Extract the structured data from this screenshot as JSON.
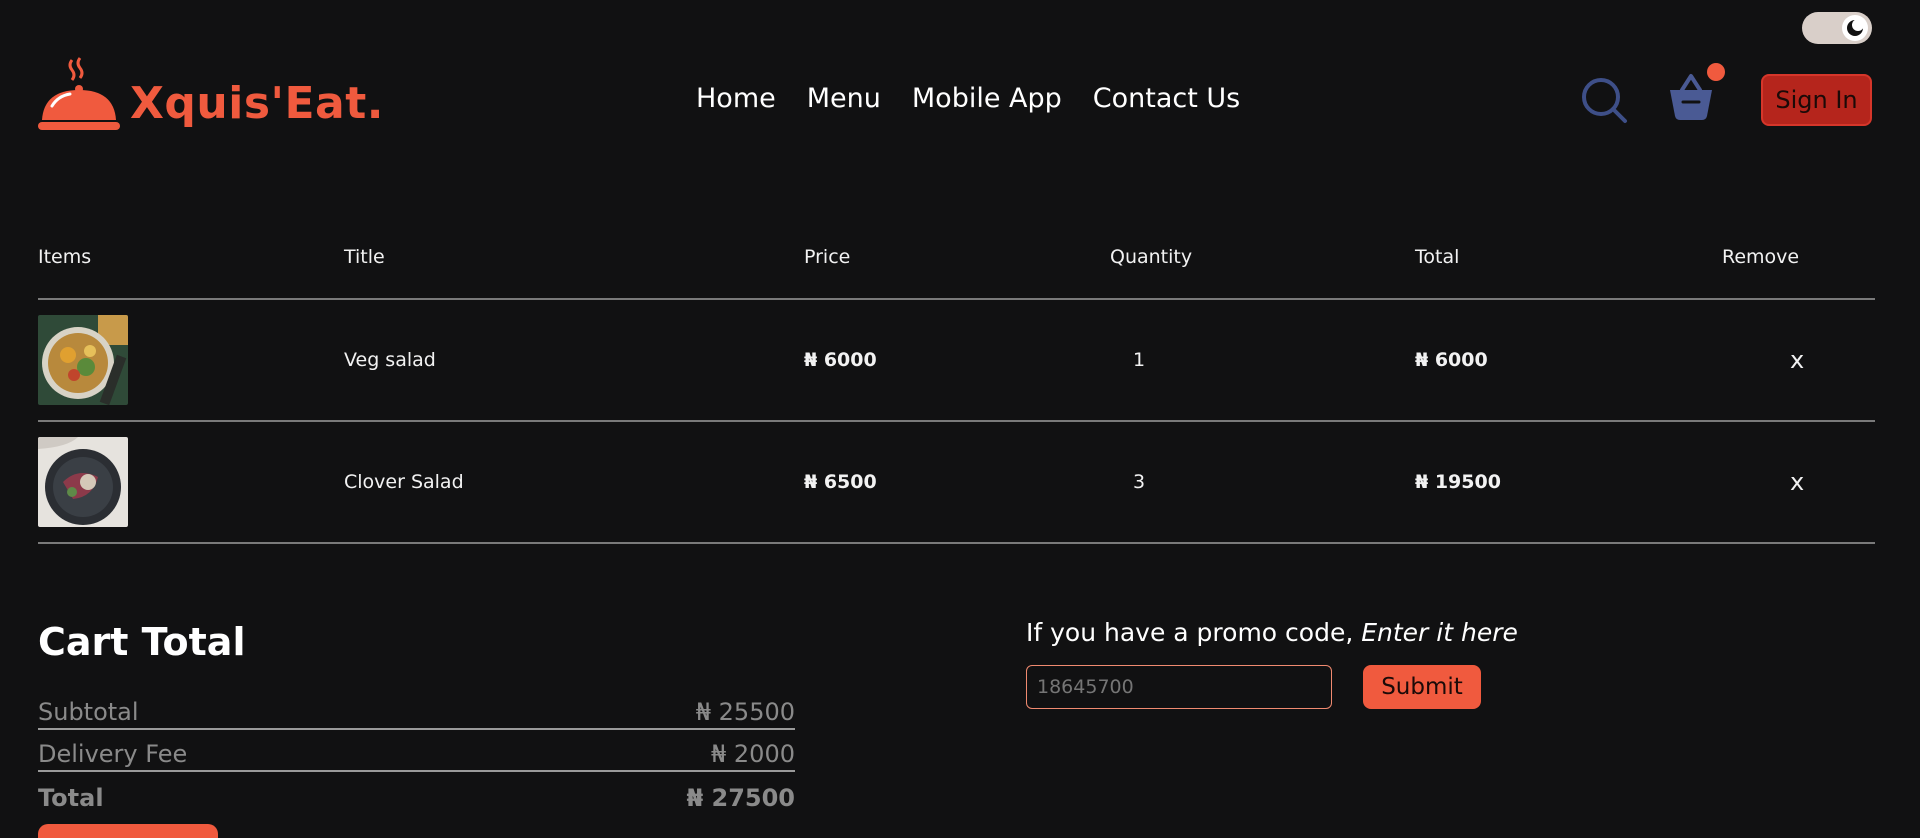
{
  "brand": {
    "name": "Xquis'Eat.",
    "accent": "#f05a3e"
  },
  "nav": [
    {
      "label": "Home"
    },
    {
      "label": "Menu"
    },
    {
      "label": "Mobile App"
    },
    {
      "label": "Contact Us"
    }
  ],
  "header": {
    "signin_label": "Sign In",
    "search_icon": "search-icon",
    "basket_icon": "basket-icon"
  },
  "table": {
    "headers": {
      "items": "Items",
      "title": "Title",
      "price": "Price",
      "quantity": "Quantity",
      "total": "Total",
      "remove": "Remove"
    },
    "rows": [
      {
        "title": "Veg salad",
        "price": "₦ 6000",
        "quantity": "1",
        "total": "₦ 6000",
        "remove": "x"
      },
      {
        "title": "Clover Salad",
        "price": "₦ 6500",
        "quantity": "3",
        "total": "₦ 19500",
        "remove": "x"
      }
    ]
  },
  "cart_total": {
    "heading": "Cart Total",
    "subtotal_label": "Subtotal",
    "subtotal_value": "₦ 25500",
    "delivery_label": "Delivery Fee",
    "delivery_value": "₦ 2000",
    "total_label": "Total",
    "total_value": "₦ 27500"
  },
  "promo": {
    "text": "If you have a promo code, ",
    "text_em": "Enter it here",
    "placeholder": "18645700",
    "submit_label": "Submit"
  }
}
